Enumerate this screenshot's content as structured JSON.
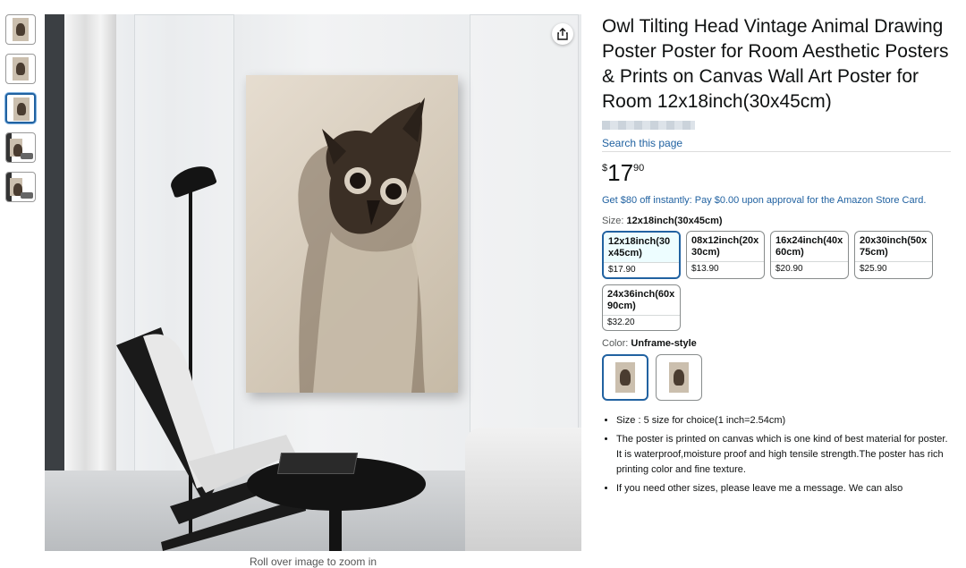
{
  "product": {
    "title": "Owl Tilting Head Vintage Animal Drawing Poster Poster for Room Aesthetic Posters & Prints on Canvas Wall Art Poster for Room 12x18inch(30x45cm)",
    "search_link": "Search this page",
    "price": {
      "symbol": "$",
      "whole": "17",
      "fraction": "90"
    },
    "promo": "Get $80 off instantly: Pay $0.00 upon approval for the Amazon Store Card.",
    "size_label": "Size:",
    "size_selected": "12x18inch(30x45cm)",
    "sizes": [
      {
        "name": "12x18inch(30x45cm)",
        "price": "$17.90",
        "selected": true
      },
      {
        "name": "08x12inch(20x30cm)",
        "price": "$13.90",
        "selected": false
      },
      {
        "name": "16x24inch(40x60cm)",
        "price": "$20.90",
        "selected": false
      },
      {
        "name": "20x30inch(50x75cm)",
        "price": "$25.90",
        "selected": false
      },
      {
        "name": "24x36inch(60x90cm)",
        "price": "$32.20",
        "selected": false
      }
    ],
    "color_label": "Color:",
    "color_selected": "Unframe-style",
    "bullets": [
      "Size : 5 size for choice(1 inch=2.54cm)",
      "The poster is printed on canvas which is one kind of best material for poster. It is waterproof,moisture proof and high tensile strength.The poster has rich printing color and fine texture.",
      "If you need other sizes, please leave me a message. We can also"
    ]
  },
  "gallery": {
    "rollover_text": "Roll over image to zoom in",
    "share_icon": "share-icon"
  }
}
